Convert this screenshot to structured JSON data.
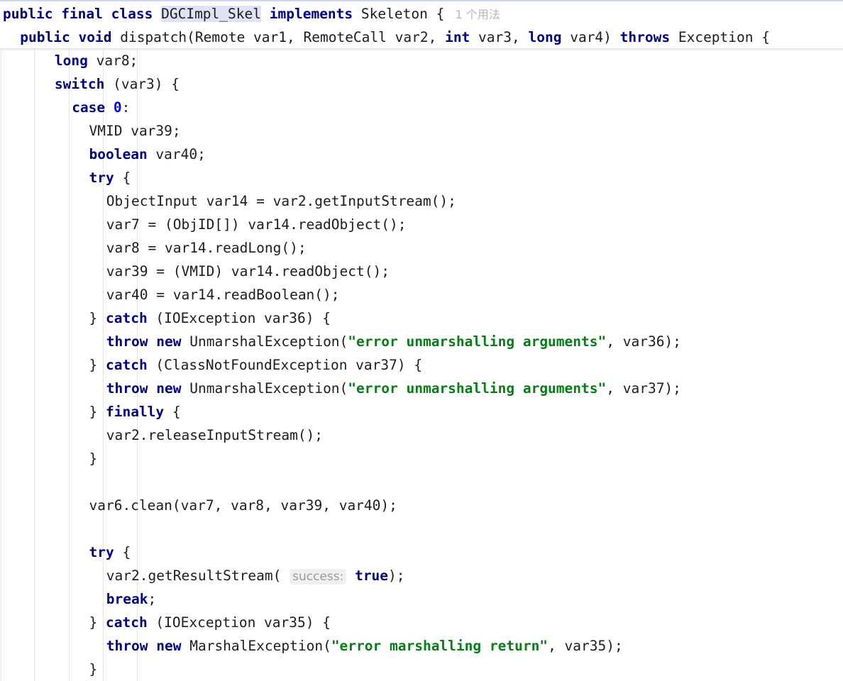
{
  "editor": {
    "language": "java",
    "font_size_px": 19.5,
    "line_height_px": 33,
    "background": "#ffffff",
    "colors": {
      "keyword": "#000082",
      "string": "#067d17",
      "number": "#0000f0",
      "plain_text": "#1d1d1d",
      "identifier_highlight_bg": "#e0e2f5",
      "inlay_hint_bg": "#f0f0f0",
      "inlay_hint_text": "#9a9a9a",
      "usage_hint_text": "#b6b6b6",
      "indent_guide": "#e6e6e6",
      "sticky_top_border": "#c9d4ef",
      "sticky_separator": "#e3e3e3"
    },
    "indent_guide_x": [
      1,
      48,
      97,
      145,
      193
    ]
  },
  "sticky_header": {
    "lines": [
      {
        "id": "class-declaration",
        "indent": 0,
        "tokens": [
          {
            "t": "public",
            "c": "kw"
          },
          {
            "t": " ",
            "c": "plain"
          },
          {
            "t": "final",
            "c": "kw"
          },
          {
            "t": " ",
            "c": "plain"
          },
          {
            "t": "class",
            "c": "kw"
          },
          {
            "t": " ",
            "c": "plain"
          },
          {
            "t": "DGCImpl_Skel",
            "c": "plain hl"
          },
          {
            "t": " ",
            "c": "plain"
          },
          {
            "t": "implements",
            "c": "kw"
          },
          {
            "t": " ",
            "c": "plain"
          },
          {
            "t": "Skeleton",
            "c": "plain"
          },
          {
            "t": " {",
            "c": "punct"
          },
          {
            "t": "   1 个用法",
            "c": "usage"
          }
        ]
      },
      {
        "id": "method-declaration",
        "indent": 1,
        "tokens": [
          {
            "t": "public",
            "c": "kw"
          },
          {
            "t": " ",
            "c": "plain"
          },
          {
            "t": "void",
            "c": "kw"
          },
          {
            "t": " dispatch(Remote var1, RemoteCall var2, ",
            "c": "plain"
          },
          {
            "t": "int",
            "c": "kw"
          },
          {
            "t": " var3, ",
            "c": "plain"
          },
          {
            "t": "long",
            "c": "kw"
          },
          {
            "t": " var4) ",
            "c": "plain"
          },
          {
            "t": "throws",
            "c": "kw"
          },
          {
            "t": " Exception {",
            "c": "plain"
          }
        ]
      }
    ]
  },
  "code_lines": [
    {
      "id": "declare-var8",
      "indent": 3,
      "tokens": [
        {
          "t": "long",
          "c": "kw"
        },
        {
          "t": " var8;",
          "c": "plain"
        }
      ]
    },
    {
      "id": "switch-statement",
      "indent": 3,
      "tokens": [
        {
          "t": "switch",
          "c": "kw"
        },
        {
          "t": " (var3) {",
          "c": "plain"
        }
      ]
    },
    {
      "id": "case-zero",
      "indent": 4,
      "tokens": [
        {
          "t": "case",
          "c": "kw"
        },
        {
          "t": " ",
          "c": "plain"
        },
        {
          "t": "0",
          "c": "num"
        },
        {
          "t": ":",
          "c": "plain"
        }
      ]
    },
    {
      "id": "declare-var39",
      "indent": 5,
      "tokens": [
        {
          "t": "VMID var39;",
          "c": "plain"
        }
      ]
    },
    {
      "id": "declare-var40",
      "indent": 5,
      "tokens": [
        {
          "t": "boolean",
          "c": "kw"
        },
        {
          "t": " var40;",
          "c": "plain"
        }
      ]
    },
    {
      "id": "try-open-1",
      "indent": 5,
      "tokens": [
        {
          "t": "try",
          "c": "kw"
        },
        {
          "t": " {",
          "c": "plain"
        }
      ]
    },
    {
      "id": "get-input-stream",
      "indent": 6,
      "tokens": [
        {
          "t": "ObjectInput var14 = var2.getInputStream();",
          "c": "plain"
        }
      ]
    },
    {
      "id": "read-objid-array",
      "indent": 6,
      "tokens": [
        {
          "t": "var7 = (ObjID[]) var14.readObject();",
          "c": "plain"
        }
      ]
    },
    {
      "id": "read-long",
      "indent": 6,
      "tokens": [
        {
          "t": "var8 = var14.readLong();",
          "c": "plain"
        }
      ]
    },
    {
      "id": "read-vmid",
      "indent": 6,
      "tokens": [
        {
          "t": "var39 = (VMID) var14.readObject();",
          "c": "plain"
        }
      ]
    },
    {
      "id": "read-boolean",
      "indent": 6,
      "tokens": [
        {
          "t": "var40 = var14.readBoolean();",
          "c": "plain"
        }
      ]
    },
    {
      "id": "catch-ioexception-36",
      "indent": 5,
      "tokens": [
        {
          "t": "} ",
          "c": "plain"
        },
        {
          "t": "catch",
          "c": "kw"
        },
        {
          "t": " (IOException var36) {",
          "c": "plain"
        }
      ]
    },
    {
      "id": "throw-unmarshal-36",
      "indent": 6,
      "tokens": [
        {
          "t": "throw",
          "c": "kw"
        },
        {
          "t": " ",
          "c": "plain"
        },
        {
          "t": "new",
          "c": "kw"
        },
        {
          "t": " UnmarshalException(",
          "c": "plain"
        },
        {
          "t": "\"error unmarshalling arguments\"",
          "c": "str"
        },
        {
          "t": ", var36);",
          "c": "plain"
        }
      ]
    },
    {
      "id": "catch-classnotfound-37",
      "indent": 5,
      "tokens": [
        {
          "t": "} ",
          "c": "plain"
        },
        {
          "t": "catch",
          "c": "kw"
        },
        {
          "t": " (ClassNotFoundException var37) {",
          "c": "plain"
        }
      ]
    },
    {
      "id": "throw-unmarshal-37",
      "indent": 6,
      "tokens": [
        {
          "t": "throw",
          "c": "kw"
        },
        {
          "t": " ",
          "c": "plain"
        },
        {
          "t": "new",
          "c": "kw"
        },
        {
          "t": " UnmarshalException(",
          "c": "plain"
        },
        {
          "t": "\"error unmarshalling arguments\"",
          "c": "str"
        },
        {
          "t": ", var37);",
          "c": "plain"
        }
      ]
    },
    {
      "id": "finally-open",
      "indent": 5,
      "tokens": [
        {
          "t": "} ",
          "c": "plain"
        },
        {
          "t": "finally",
          "c": "kw"
        },
        {
          "t": " {",
          "c": "plain"
        }
      ]
    },
    {
      "id": "release-input-stream",
      "indent": 6,
      "tokens": [
        {
          "t": "var2.releaseInputStream();",
          "c": "plain"
        }
      ]
    },
    {
      "id": "finally-close",
      "indent": 5,
      "tokens": [
        {
          "t": "}",
          "c": "plain"
        }
      ]
    },
    {
      "id": "blank-1",
      "indent": 0,
      "tokens": []
    },
    {
      "id": "call-clean",
      "indent": 5,
      "tokens": [
        {
          "t": "var6.clean(var7, var8, var39, var40);",
          "c": "plain"
        }
      ]
    },
    {
      "id": "blank-2",
      "indent": 0,
      "tokens": []
    },
    {
      "id": "try-open-2",
      "indent": 5,
      "tokens": [
        {
          "t": "try",
          "c": "kw"
        },
        {
          "t": " {",
          "c": "plain"
        }
      ]
    },
    {
      "id": "get-result-stream",
      "indent": 6,
      "tokens": [
        {
          "t": "var2.getResultStream(",
          "c": "plain"
        },
        {
          "t": " ",
          "c": "plain"
        },
        {
          "t": "success:",
          "c": "inlay"
        },
        {
          "t": " ",
          "c": "plain"
        },
        {
          "t": "true",
          "c": "kw"
        },
        {
          "t": ");",
          "c": "plain"
        }
      ]
    },
    {
      "id": "break-statement",
      "indent": 6,
      "tokens": [
        {
          "t": "break",
          "c": "kw"
        },
        {
          "t": ";",
          "c": "plain"
        }
      ]
    },
    {
      "id": "catch-ioexception-35",
      "indent": 5,
      "tokens": [
        {
          "t": "} ",
          "c": "plain"
        },
        {
          "t": "catch",
          "c": "kw"
        },
        {
          "t": " (IOException var35) {",
          "c": "plain"
        }
      ]
    },
    {
      "id": "throw-marshal-35",
      "indent": 6,
      "tokens": [
        {
          "t": "throw",
          "c": "kw"
        },
        {
          "t": " ",
          "c": "plain"
        },
        {
          "t": "new",
          "c": "kw"
        },
        {
          "t": " MarshalException(",
          "c": "plain"
        },
        {
          "t": "\"error marshalling return\"",
          "c": "str"
        },
        {
          "t": ", var35);",
          "c": "plain"
        }
      ]
    },
    {
      "id": "catch-close-35",
      "indent": 5,
      "tokens": [
        {
          "t": "}",
          "c": "plain"
        }
      ]
    }
  ]
}
